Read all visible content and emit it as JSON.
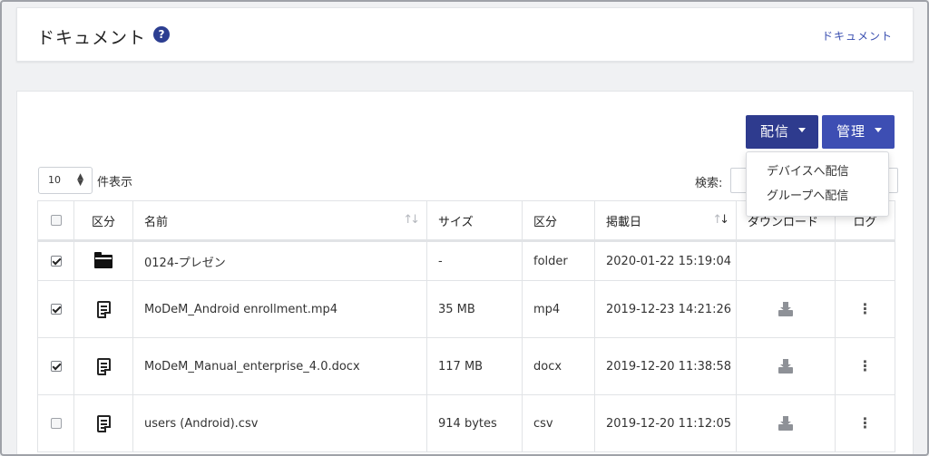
{
  "header": {
    "title": "ドキュメント",
    "help_icon": "?",
    "breadcrumb": "ドキュメント"
  },
  "toolbar": {
    "deliver_label": "配信",
    "manage_label": "管理",
    "deliver_menu": [
      "デバイスへ配信",
      "グループへ配信"
    ]
  },
  "table_controls": {
    "page_length": "10",
    "page_length_label": "件表示",
    "search_label": "検索:",
    "search_value": ""
  },
  "colors": {
    "primary_dark": "#2e3b8e",
    "primary": "#3d4eb3",
    "link": "#3a4fb0"
  },
  "table": {
    "columns": [
      "",
      "区分",
      "名前",
      "サイズ",
      "区分",
      "掲載日",
      "ダウンロード",
      "ログ"
    ],
    "rows": [
      {
        "checked": true,
        "icon": "folder-icon",
        "name": "0124-プレゼン",
        "size": "-",
        "type": "folder",
        "date": "2020-01-22 15:19:04",
        "download": false,
        "log": false
      },
      {
        "checked": true,
        "icon": "file-icon",
        "name": "MoDeM_Android enrollment.mp4",
        "size": "35 MB",
        "type": "mp4",
        "date": "2019-12-23 14:21:26",
        "download": true,
        "log": true
      },
      {
        "checked": true,
        "icon": "file-icon",
        "name": "MoDeM_Manual_enterprise_4.0.docx",
        "size": "117 MB",
        "type": "docx",
        "date": "2019-12-20 11:38:58",
        "download": true,
        "log": true
      },
      {
        "checked": false,
        "icon": "file-icon",
        "name": "users (Android).csv",
        "size": "914 bytes",
        "type": "csv",
        "date": "2019-12-20 11:12:05",
        "download": true,
        "log": true
      }
    ]
  }
}
